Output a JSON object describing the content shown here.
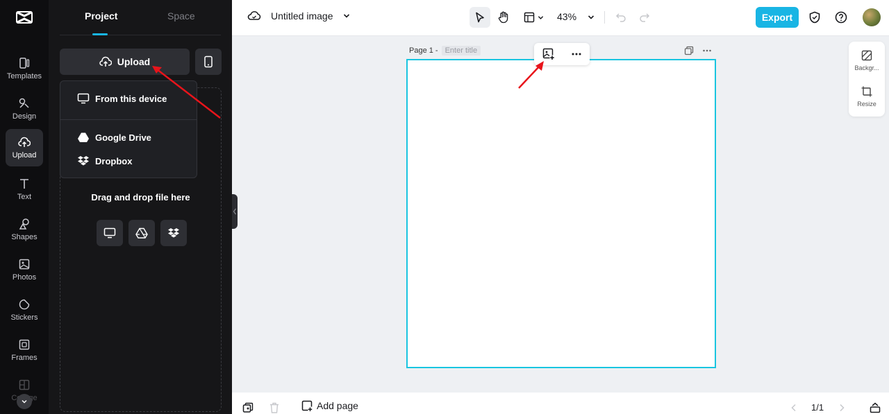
{
  "rail": {
    "items": [
      {
        "label": "Templates",
        "icon": "templates-icon"
      },
      {
        "label": "Design",
        "icon": "design-icon"
      },
      {
        "label": "Upload",
        "icon": "cloud-upload-icon",
        "active": true
      },
      {
        "label": "Text",
        "icon": "text-icon"
      },
      {
        "label": "Shapes",
        "icon": "shapes-icon"
      },
      {
        "label": "Photos",
        "icon": "photos-icon"
      },
      {
        "label": "Stickers",
        "icon": "stickers-icon"
      },
      {
        "label": "Frames",
        "icon": "frames-icon"
      },
      {
        "label": "Collage",
        "icon": "collage-icon"
      }
    ]
  },
  "panel": {
    "tabs": [
      "Project",
      "Space"
    ],
    "upload_label": "Upload",
    "menu": [
      "From this device",
      "Google Drive",
      "Dropbox"
    ],
    "drag_text": "Drag and drop file here"
  },
  "topbar": {
    "doc_title": "Untitled image",
    "zoom": "43%",
    "export_label": "Export"
  },
  "canvas": {
    "page_label": "Page 1 -",
    "title_placeholder": "Enter title"
  },
  "rpanel": {
    "items": [
      "Backgr...",
      "Resize"
    ]
  },
  "bottombar": {
    "add_page_label": "Add page",
    "page_count": "1/1"
  },
  "colors": {
    "accent": "#19b5e4",
    "annotation_arrow": "#e8141b"
  }
}
